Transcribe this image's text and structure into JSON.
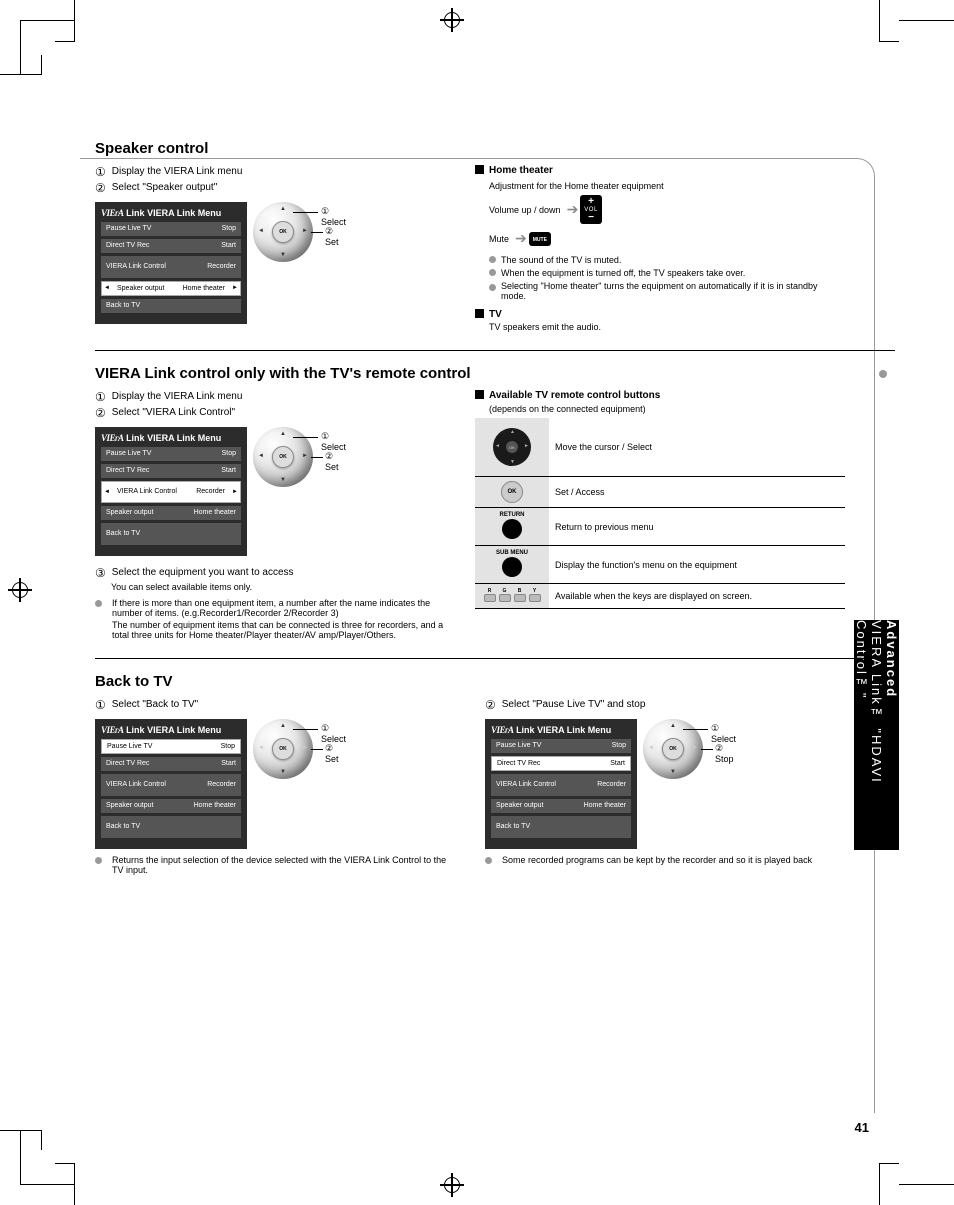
{
  "page_number": "41",
  "side_tab": "VIERA Link™ \"HDAVI Control™\"",
  "side_tab_sub": "Advanced",
  "sections": {
    "speaker": {
      "title": "Speaker control",
      "step1": {
        "num": "①",
        "text": "Display the VIERA Link menu"
      },
      "step2": {
        "num": "②",
        "text": "Select \"Speaker output\""
      },
      "pad_sel": "① Select",
      "pad_set": "② Set",
      "menu": {
        "title": "VIERA Link Menu",
        "rows": [
          {
            "k": "Pause Live TV",
            "v": "Stop"
          },
          {
            "k": "Direct TV Rec",
            "v": "Start"
          },
          {
            "k": "VIERA Link Control",
            "v": "Recorder",
            "tall": true
          },
          {
            "k": "Speaker output",
            "v": "Home theater",
            "active": true
          },
          {
            "k": "Back to TV",
            "v": ""
          }
        ]
      },
      "right": {
        "heading": "Home theater",
        "line1": "Adjustment for the Home theater equipment",
        "vol_line": "Volume up / down",
        "mute_line": "Mute",
        "bullets": [
          "The sound of the TV is muted.",
          "When the equipment is turned off, the TV speakers take over.",
          "Selecting \"Home theater\" turns the equipment on automatically if it is in standby mode."
        ],
        "tv_heading": "TV",
        "tv_line": "TV speakers emit the audio."
      }
    },
    "control": {
      "title": "VIERA Link control only with the TV's remote control",
      "step1": {
        "num": "①",
        "text": "Display the VIERA Link menu"
      },
      "step2": {
        "num": "②",
        "text": "Select \"VIERA Link Control\""
      },
      "pad_sel": "① Select",
      "pad_set": "② Set",
      "menu": {
        "title": "VIERA Link Menu",
        "rows": [
          {
            "k": "Pause Live TV",
            "v": "Stop"
          },
          {
            "k": "Direct TV Rec",
            "v": "Start"
          },
          {
            "k": "VIERA Link Control",
            "v": "Recorder",
            "active": true,
            "tall": true
          },
          {
            "k": "Speaker output",
            "v": "Home theater"
          },
          {
            "k": "Back to TV",
            "v": "",
            "tall": true
          }
        ]
      },
      "step3": {
        "num": "③",
        "text": "Select the equipment you want to access"
      },
      "step3_sub": "You can select available items only.",
      "note": "If there is more than one equipment item, a number after the name indicates the number of items. (e.g.Recorder1/Recorder 2/Recorder 3)",
      "note2": "The number of equipment items that can be connected is three for recorders, and a total three units for Home theater/Player theater/AV amp/Player/Others.",
      "right_heading": "Available TV remote control buttons",
      "right_sub": "(depends on the connected equipment)",
      "table": [
        {
          "icon": "pad",
          "desc": "Move the cursor / Select"
        },
        {
          "icon": "ok",
          "desc": "Set / Access"
        },
        {
          "icon": "return",
          "lbl": "RETURN",
          "desc": "Return to previous menu"
        },
        {
          "icon": "submenu",
          "lbl": "SUB MENU",
          "desc": "Display the function's menu on the equipment"
        },
        {
          "icon": "colors",
          "desc": "Available when the keys are displayed on screen."
        }
      ],
      "color_labels": [
        "R",
        "G",
        "B",
        "Y"
      ]
    },
    "back": {
      "title": "Back to TV",
      "left": {
        "step": {
          "num": "①",
          "text": "Select \"Back to TV\""
        },
        "menu_title": "VIERA Link Menu",
        "rows": [
          {
            "k": "Pause Live TV",
            "v": "Stop",
            "active": true
          },
          {
            "k": "Direct TV Rec",
            "v": "Start"
          },
          {
            "k": "VIERA Link Control",
            "v": "Recorder",
            "tall": true
          },
          {
            "k": "Speaker output",
            "v": "Home theater"
          },
          {
            "k": "Back to TV",
            "v": "",
            "tall": true
          }
        ],
        "pad_sel": "① Select",
        "pad_set": "② Set",
        "foot": "Returns the input selection of the device selected with the VIERA Link Control to the TV input."
      },
      "right": {
        "step": {
          "num": "②",
          "text": "Select \"Pause Live TV\" and stop"
        },
        "menu_title": "VIERA Link Menu",
        "rows": [
          {
            "k": "Pause Live TV",
            "v": "Stop"
          },
          {
            "k": "Direct TV Rec",
            "v": "Start",
            "active": true
          },
          {
            "k": "VIERA Link Control",
            "v": "Recorder",
            "tall": true
          },
          {
            "k": "Speaker output",
            "v": "Home theater"
          },
          {
            "k": "Back to TV",
            "v": "",
            "tall": true
          }
        ],
        "pad_sel": "① Select",
        "pad_set": "② Stop",
        "foot": "Some recorded programs can be kept by the recorder and so it is played back"
      }
    }
  }
}
